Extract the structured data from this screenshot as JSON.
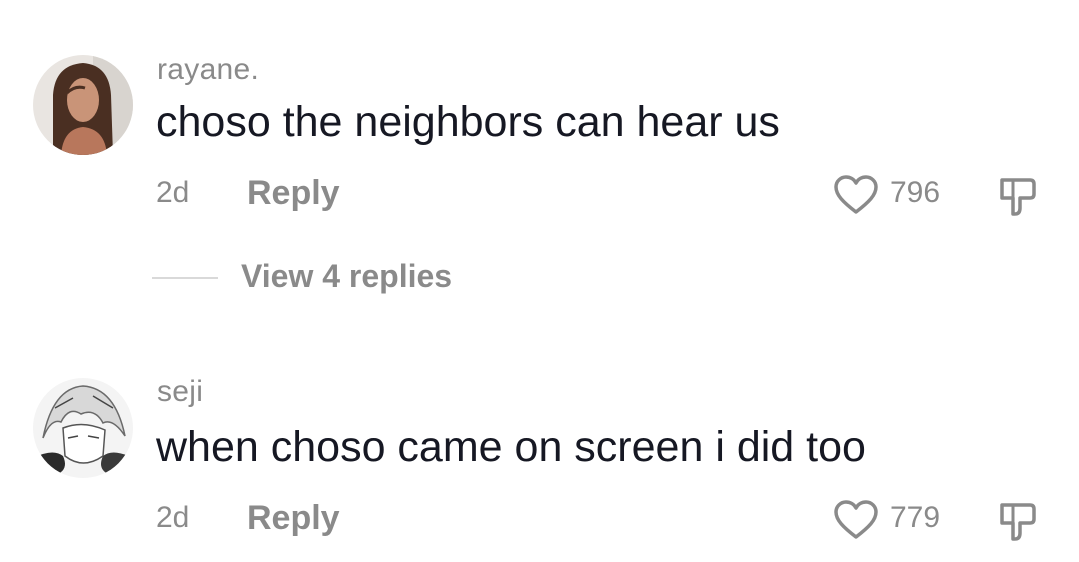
{
  "comments": [
    {
      "username": "rayane.",
      "text": "choso the neighbors can hear us",
      "timestamp": "2d",
      "reply_label": "Reply",
      "like_count": "796",
      "view_replies_label": "View 4 replies",
      "avatar_icon": "user-photo-avatar"
    },
    {
      "username": "seji",
      "text": "when choso came on screen i did too",
      "timestamp": "2d",
      "reply_label": "Reply",
      "like_count": "779",
      "avatar_icon": "anime-drawing-avatar"
    }
  ],
  "icons": {
    "like": "heart-outline-icon",
    "dislike": "thumbs-down-icon"
  },
  "colors": {
    "primary_text": "#161823",
    "secondary_text": "#8a8a8a",
    "divider": "#d9d9d9",
    "background": "#ffffff"
  }
}
